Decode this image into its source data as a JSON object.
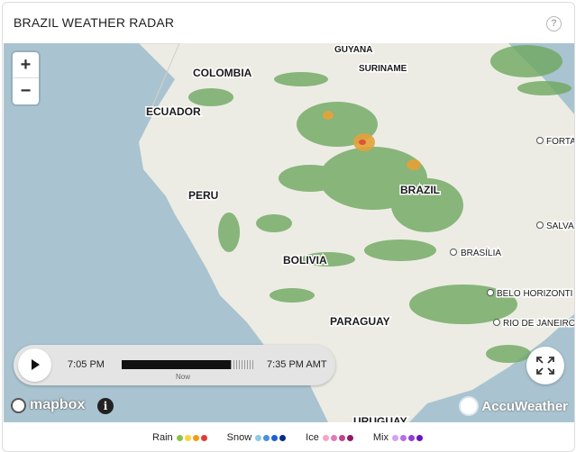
{
  "header": {
    "title": "BRAZIL WEATHER RADAR",
    "help_glyph": "?"
  },
  "map": {
    "country_labels": [
      "GUYANA",
      "SURINAME",
      "COLOMBIA",
      "ECUADOR",
      "PERU",
      "BRAZIL",
      "BOLIVIA",
      "PARAGUAY",
      "URUGUAY"
    ],
    "city_labels": [
      "FORTA",
      "SALVA",
      "BRASÍLIA",
      "BELO HORIZONTI",
      "RIO DE JANEIRO"
    ],
    "zoom_in": "+",
    "zoom_out": "−",
    "attribution_left": "mapbox",
    "info_glyph": "i",
    "attribution_right": "AccuWeather"
  },
  "player": {
    "start_time": "7:05 PM",
    "end_time": "7:35 PM AMT",
    "now_label": "Now"
  },
  "legend": [
    {
      "label": "Rain",
      "colors": [
        "#8bc34a",
        "#ffd23f",
        "#f39c12",
        "#e53935"
      ]
    },
    {
      "label": "Snow",
      "colors": [
        "#8ecae6",
        "#4a90e2",
        "#1e5fd6",
        "#0a2a8a"
      ]
    },
    {
      "label": "Ice",
      "colors": [
        "#f4a6c9",
        "#e07cb5",
        "#c2448e",
        "#8e1a66"
      ]
    },
    {
      "label": "Mix",
      "colors": [
        "#d0a3f0",
        "#b070e6",
        "#8e3fd6",
        "#6a14b8"
      ]
    }
  ]
}
